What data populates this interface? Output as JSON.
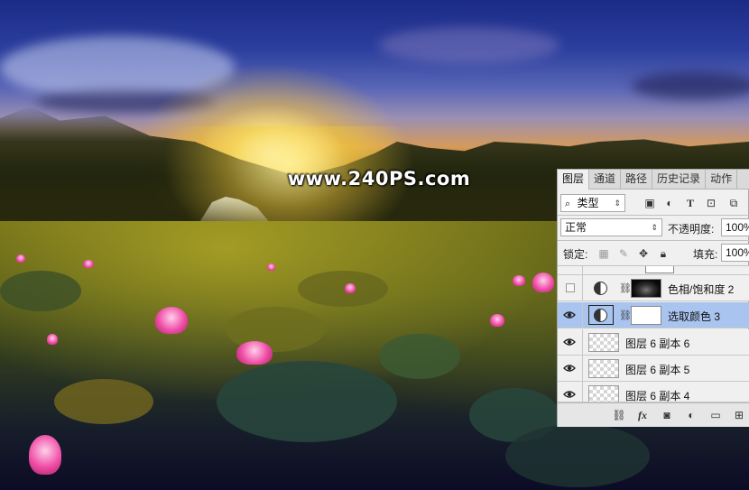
{
  "watermark": "www.240PS.com",
  "panel": {
    "tabs": [
      "图层",
      "通道",
      "路径",
      "历史记录",
      "动作"
    ],
    "active_tab": "图层",
    "filter": {
      "label": "类型",
      "search_icon": "search-icon"
    },
    "blend_mode": "正常",
    "opacity_label": "不透明度:",
    "opacity_value": "100%",
    "lock_label": "锁定:",
    "fill_label": "填充:",
    "fill_value": "100%",
    "layers": [
      {
        "name": "色相/饱和度 2",
        "visible": false,
        "type": "adjustment",
        "mask": "dark",
        "selected": false
      },
      {
        "name": "选取颜色 3",
        "visible": true,
        "type": "adjustment",
        "mask": "white",
        "selected": true
      },
      {
        "name": "图层 6 副本 6",
        "visible": true,
        "type": "pixel",
        "selected": false
      },
      {
        "name": "图层 6 副本 5",
        "visible": true,
        "type": "pixel",
        "selected": false
      },
      {
        "name": "图层 6 副本 4",
        "visible": true,
        "type": "pixel",
        "selected": false
      }
    ],
    "bottom_icons": [
      "link-icon",
      "fx-icon",
      "mask-icon",
      "adjustment-icon",
      "folder-icon",
      "new-layer-icon"
    ],
    "fx_label": "fx"
  }
}
